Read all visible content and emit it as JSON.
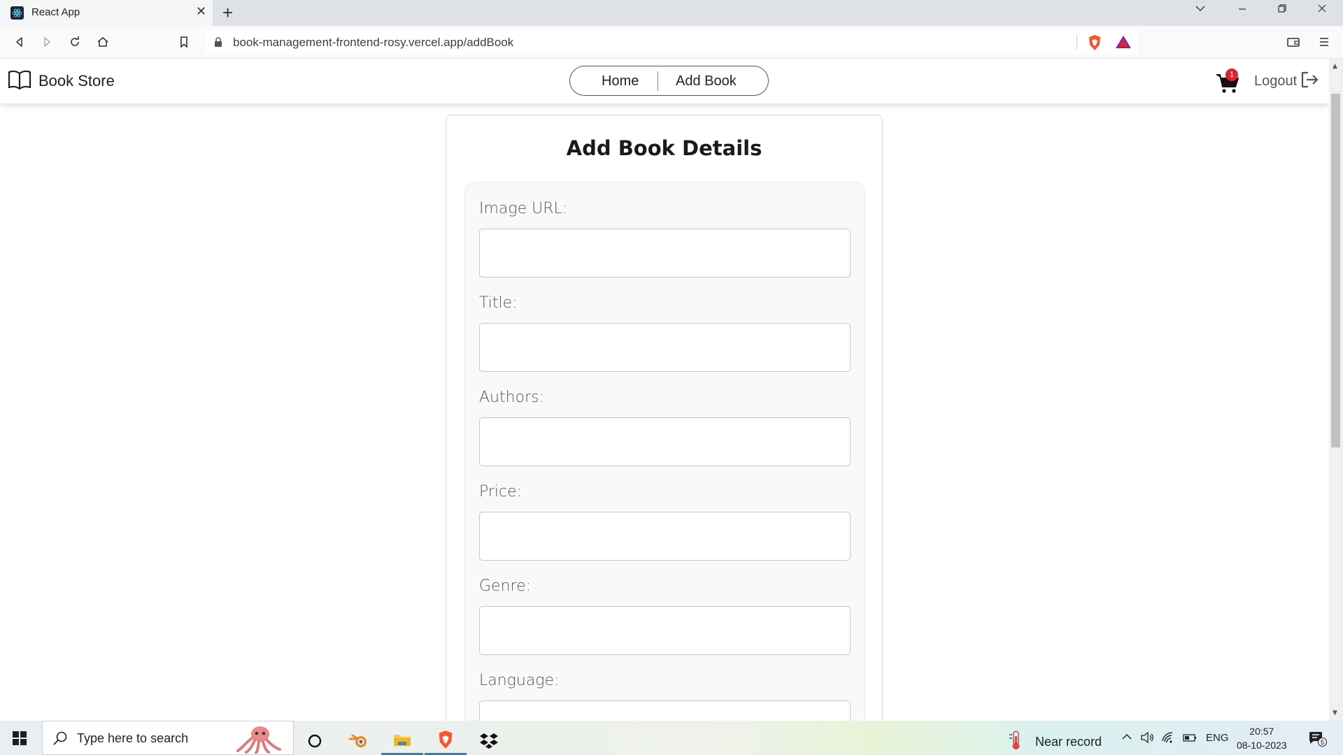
{
  "browser": {
    "tab_title": "React App",
    "url": "book-management-frontend-rosy.vercel.app/addBook"
  },
  "app": {
    "brand": "Book Store",
    "nav": {
      "home": "Home",
      "add_book": "Add Book"
    },
    "cart_count": "1",
    "logout": "Logout"
  },
  "form": {
    "heading": "Add Book Details",
    "fields": [
      {
        "label": "Image URL:",
        "value": ""
      },
      {
        "label": "Title:",
        "value": ""
      },
      {
        "label": "Authors:",
        "value": ""
      },
      {
        "label": "Price:",
        "value": ""
      },
      {
        "label": "Genre:",
        "value": ""
      },
      {
        "label": "Language:",
        "value": ""
      }
    ]
  },
  "taskbar": {
    "search_placeholder": "Type here to search",
    "weather": "Near record",
    "language": "ENG",
    "time": "20:57",
    "date": "08-10-2023",
    "notifications": "5"
  }
}
